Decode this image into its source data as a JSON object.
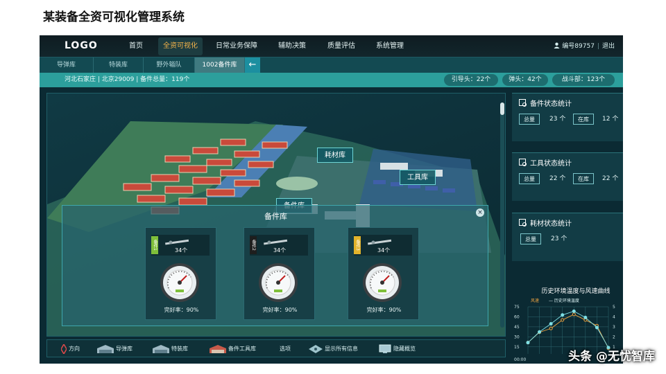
{
  "slide_title": "某装备全资可视化管理系统",
  "app": {
    "logo": "LOGO",
    "nav": [
      {
        "label": "首页",
        "active": false
      },
      {
        "label": "全资可视化",
        "active": true
      },
      {
        "label": "日常业务保障",
        "active": false
      },
      {
        "label": "辅助决策",
        "active": false
      },
      {
        "label": "质量评估",
        "active": false
      },
      {
        "label": "系统管理",
        "active": false
      }
    ],
    "user": {
      "id_label": "编号89757",
      "logout": "退出"
    },
    "subtabs": [
      {
        "label": "导弹库",
        "active": false
      },
      {
        "label": "特装库",
        "active": false
      },
      {
        "label": "野外辎队",
        "active": false
      },
      {
        "label": "1002备件库",
        "active": true
      }
    ],
    "back_glyph": "←",
    "info": {
      "location": "河北石家庄 | 北京29009 | 备件总量：119个",
      "pills": [
        "引导头：22个",
        "弹头：42个",
        "战斗部：123个"
      ]
    },
    "scene_labels": {
      "consumables": "耗材库",
      "tools": "工具库",
      "spares": "备件库"
    },
    "popup": {
      "title": "备件库",
      "close": "×",
      "cards": [
        {
          "tag": "备件1",
          "count": "34个",
          "rate": "完好率：90%",
          "tag_color": "#7fbf3a"
        },
        {
          "tag": "备件2",
          "count": "34个",
          "rate": "完好率：90%",
          "tag_color": "#1e1e1e"
        },
        {
          "tag": "备件3",
          "count": "34个",
          "rate": "完好率：90%",
          "tag_color": "#e2b32b"
        }
      ]
    },
    "toolbar": [
      "方向",
      "导弹库",
      "特装库",
      "备件工具库",
      "选项",
      "显示所有信息",
      "隐藏概览"
    ],
    "stats": [
      {
        "title": "备件状态统计",
        "total_label": "总量",
        "total": "23 个",
        "instock_label": "在库",
        "instock": "12 个"
      },
      {
        "title": "工具状态统计",
        "total_label": "总量",
        "total": "22 个",
        "instock_label": "在库",
        "instock": "22 个"
      },
      {
        "title": "耗材状态统计",
        "total_label": "总量",
        "total": "23 个"
      }
    ],
    "chart_title": "历史环境温度与风速曲线"
  },
  "chart_data": {
    "type": "line",
    "title": "历史环境温度与风速曲线",
    "legend": [
      "风速",
      "历史环境温度"
    ],
    "y_left_ticks": [
      75,
      60,
      45,
      30,
      15
    ],
    "y_right_ticks": [
      5,
      4,
      3,
      2,
      1
    ],
    "x_tick_label": "00:00",
    "series": [
      {
        "name": "风速",
        "values": [
          1.2,
          2.3,
          2.7,
          3.6,
          4.2,
          3.6,
          3.0,
          0.6
        ],
        "color": "#f0a541"
      },
      {
        "name": "历史环境温度",
        "values": [
          18,
          35,
          48,
          62,
          68,
          58,
          42,
          10
        ],
        "color": "#7fe0e6"
      }
    ],
    "ylim_left": [
      0,
      75
    ],
    "ylim_right": [
      0,
      5
    ],
    "grid": true
  },
  "watermark": "头条 @无忧智库"
}
